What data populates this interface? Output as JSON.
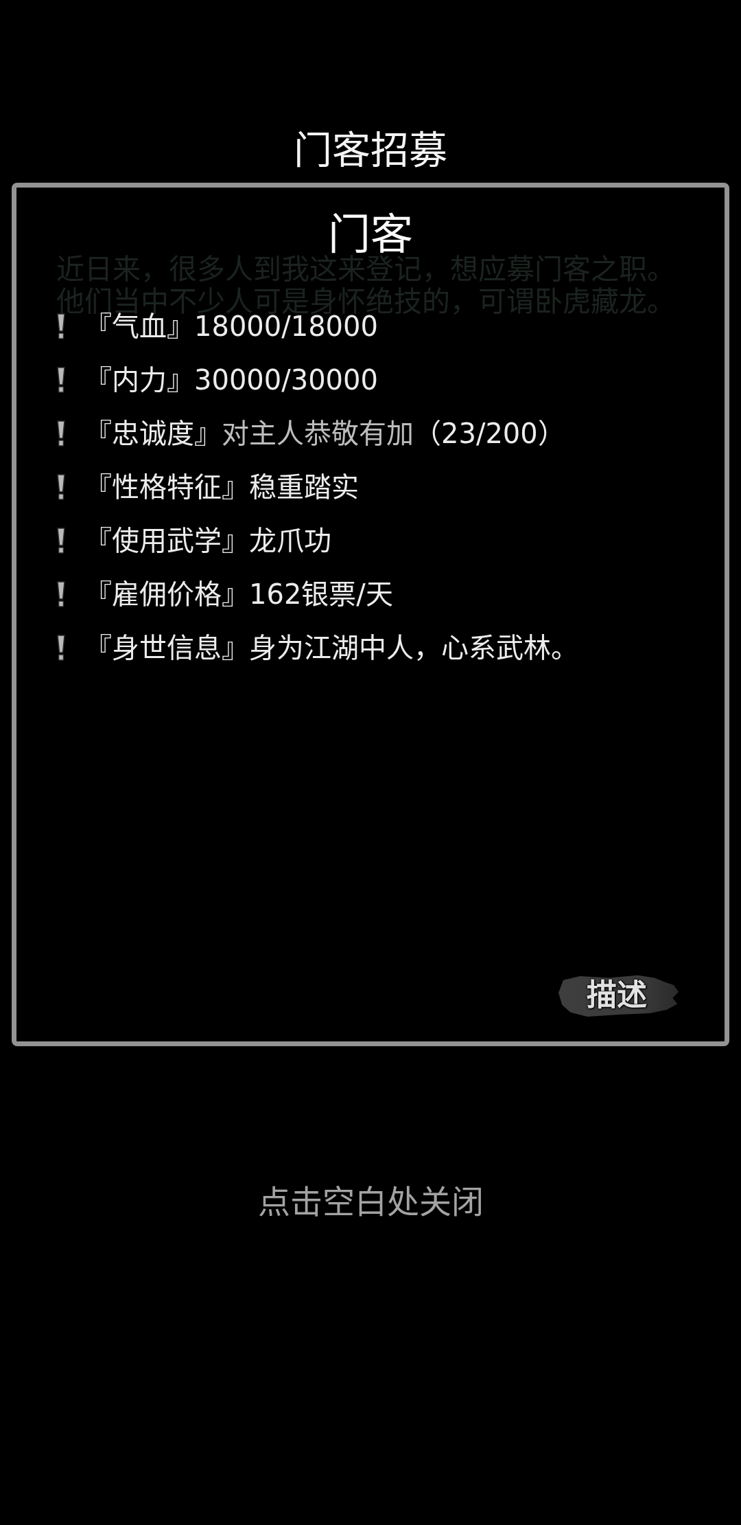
{
  "header": {
    "title": "门客招募"
  },
  "dialog": {
    "title": "门客",
    "backdrop_lines": [
      "近日来，很多人到我这来登记，想应募门客之职。",
      "他们当中不少人可是身怀绝技的，可谓卧虎藏龙。"
    ],
    "stats": [
      {
        "label": "『气血』",
        "value": "18000/18000"
      },
      {
        "label": "『内力』",
        "value": "30000/30000"
      },
      {
        "label": "『忠诚度』",
        "value": "对主人恭敬有加",
        "color": "#bdbdbd",
        "count": "（23/200）"
      },
      {
        "label": "『性格特征』",
        "value": "稳重踏实"
      },
      {
        "label": "『使用武学』",
        "value": "龙爪功"
      },
      {
        "label": "『雇佣价格』",
        "value": "162银票/天"
      },
      {
        "label": "『身世信息』",
        "value": "身为江湖中人，心系武林。"
      }
    ],
    "describe_button": "描述"
  },
  "close_hint": "点击空白处关闭"
}
